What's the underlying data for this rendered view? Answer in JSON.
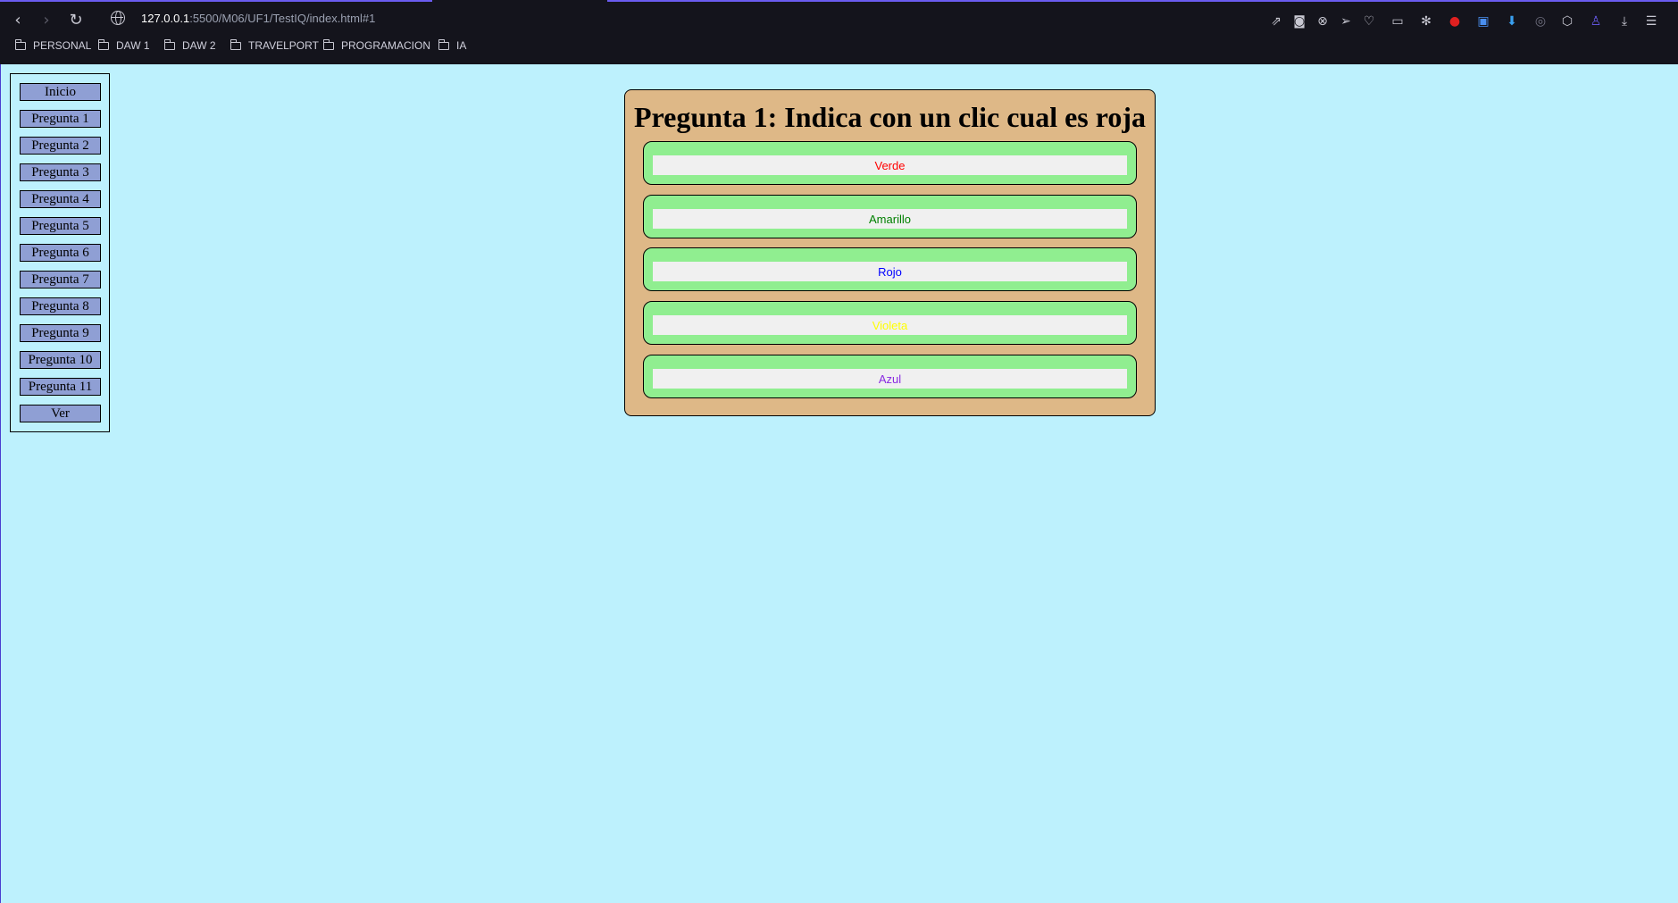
{
  "browser": {
    "url_host": "127.0.0.1",
    "url_path": ":5500/M06/UF1/TestIQ/index.html#1",
    "bookmarks": [
      {
        "label": "PERSONAL"
      },
      {
        "label": "DAW 1"
      },
      {
        "label": "DAW 2"
      },
      {
        "label": "TRAVELPORT"
      },
      {
        "label": "PROGRAMACION"
      },
      {
        "label": "IA"
      }
    ],
    "extension_icons": [
      "share-icon",
      "camera-icon",
      "shield-x-icon",
      "send-icon",
      "heart-icon",
      "reader-icon",
      "atom-icon",
      "stop-hand-icon",
      "translate-icon",
      "download-arrow-icon",
      "circle-target-icon",
      "cube-icon",
      "user-icon",
      "downloads-icon",
      "menu-icon"
    ]
  },
  "sidebar": {
    "items": [
      {
        "label": "Inicio"
      },
      {
        "label": "Pregunta 1"
      },
      {
        "label": "Pregunta 2"
      },
      {
        "label": "Pregunta 3"
      },
      {
        "label": "Pregunta 4"
      },
      {
        "label": "Pregunta 5"
      },
      {
        "label": "Pregunta 6"
      },
      {
        "label": "Pregunta 7"
      },
      {
        "label": "Pregunta 8"
      },
      {
        "label": "Pregunta 9"
      },
      {
        "label": "Pregunta 10"
      },
      {
        "label": "Pregunta 11"
      },
      {
        "label": "Ver"
      }
    ]
  },
  "question": {
    "title": "Pregunta 1: Indica con un clic cual es roja",
    "options": [
      {
        "label": "Verde",
        "color": "#ff0000"
      },
      {
        "label": "Amarillo",
        "color": "#008000"
      },
      {
        "label": "Rojo",
        "color": "#0000ff"
      },
      {
        "label": "Violeta",
        "color": "#ffff00"
      },
      {
        "label": "Azul",
        "color": "#8a2be2"
      }
    ]
  },
  "colors": {
    "page_background": "#bdf1fd",
    "panel_background": "#deb887",
    "option_background": "#90ee90",
    "sidebar_button": "#8f9fd4",
    "chrome_background": "#14141c"
  }
}
